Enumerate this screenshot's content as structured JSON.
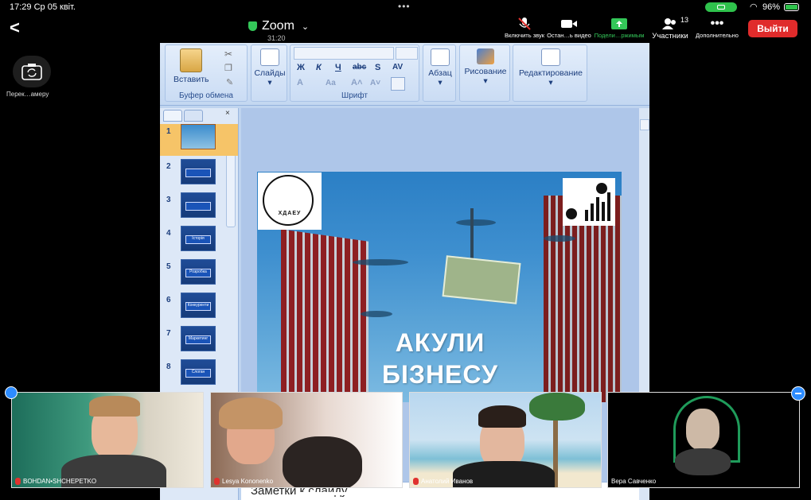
{
  "status_bar": {
    "time": "17:29",
    "date": "Ср 05 квіт.",
    "battery": "96%"
  },
  "meeting": {
    "title": "Zoom",
    "duration": "31:20"
  },
  "toolbar": {
    "unmute": "Включить звук",
    "stop_video": "Остан…ь видео",
    "share": "Подели…ржимым",
    "participants": "Участники",
    "participants_count": "13",
    "more": "Дополнительно",
    "leave": "Выйти"
  },
  "camera_switch": {
    "label": "Перек…амеру"
  },
  "ribbon": {
    "paste": "Вставить",
    "clipboard": "Буфер обмена",
    "slides": "Слайды",
    "font": "Шрифт",
    "paragraph": "Абзац",
    "drawing": "Рисование",
    "editing": "Редактирование",
    "font_buttons": [
      "Ж",
      "К",
      "Ч",
      "abc",
      "S",
      "AV"
    ]
  },
  "slides_panel": {
    "thumbnails": [
      {
        "num": "1",
        "label": ""
      },
      {
        "num": "2",
        "label": ""
      },
      {
        "num": "3",
        "label": ""
      },
      {
        "num": "4",
        "label": "Історія"
      },
      {
        "num": "5",
        "label": "Розробка"
      },
      {
        "num": "6",
        "label": "Конкуренти"
      },
      {
        "num": "7",
        "label": "Маркетинг"
      },
      {
        "num": "8",
        "label": "Слоган"
      }
    ]
  },
  "slide": {
    "title_line1": "АКУЛИ",
    "title_line2": "БІЗНЕСУ",
    "logo_text": "ХДАЕУ"
  },
  "notes": {
    "placeholder": "Заметки к слайду"
  },
  "participants": [
    {
      "name": "BOHDAN•SHCHEPETKO"
    },
    {
      "name": "Lesya Kononenko"
    },
    {
      "name": "Анатолий Иванов"
    },
    {
      "name": "Вера Савченко"
    }
  ]
}
